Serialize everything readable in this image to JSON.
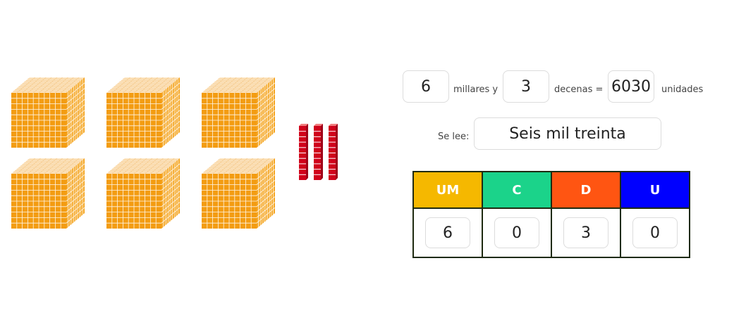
{
  "manipulatives": {
    "thousand_cubes": 6,
    "ten_rods": 3,
    "cube_front_color": "#F39C12",
    "cube_top_color": "#FDE8C8",
    "cube_side_color": "#F5A623",
    "rod_color": "#D0021B"
  },
  "equation": {
    "thousands_value": "6",
    "thousands_label": "millares y",
    "tens_value": "3",
    "tens_label": "decenas =",
    "units_value": "6030",
    "units_label": "unidades"
  },
  "reading": {
    "label": "Se lee:",
    "value": "Seis mil treinta"
  },
  "place_table": {
    "headers": [
      {
        "label": "UM",
        "color": "#F5B800"
      },
      {
        "label": "C",
        "color": "#1BD38A"
      },
      {
        "label": "D",
        "color": "#FF5512"
      },
      {
        "label": "U",
        "color": "#0000FF"
      }
    ],
    "values": [
      "6",
      "0",
      "3",
      "0"
    ]
  }
}
